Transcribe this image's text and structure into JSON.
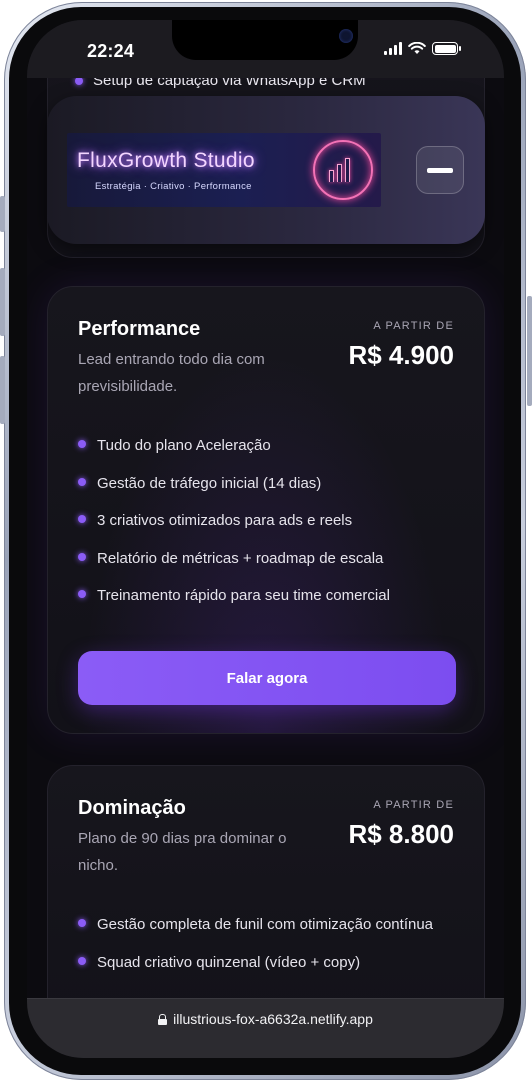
{
  "status_bar": {
    "time": "22:24"
  },
  "partial_item": "Setup de captação via WhatsApp e CRM",
  "banner": {
    "logo_title": "FluxGrowth Studio",
    "logo_subtitle": "Estratégia · Criativo · Performance"
  },
  "plans": [
    {
      "name": "Performance",
      "description": "Lead entrando todo dia com previsibilidade.",
      "price_label": "A PARTIR DE",
      "price": "R$ 4.900",
      "features": [
        "Tudo do plano Aceleração",
        "Gestão de tráfego inicial (14 dias)",
        "3 criativos otimizados para ads e reels",
        "Relatório de métricas + roadmap de escala",
        "Treinamento rápido para seu time comercial"
      ],
      "cta": "Falar agora"
    },
    {
      "name": "Dominação",
      "description": "Plano de 90 dias pra dominar o nicho.",
      "price_label": "A PARTIR DE",
      "price": "R$ 8.800",
      "features": [
        "Gestão completa de funil com otimização contínua",
        "Squad criativo quinzenal (vídeo + copy)"
      ]
    }
  ],
  "browser": {
    "url": "illustrious-fox-a6632a.netlify.app"
  },
  "colors": {
    "accent": "#8b5cf6",
    "background": "#0c0b10",
    "card": "#16151c"
  }
}
